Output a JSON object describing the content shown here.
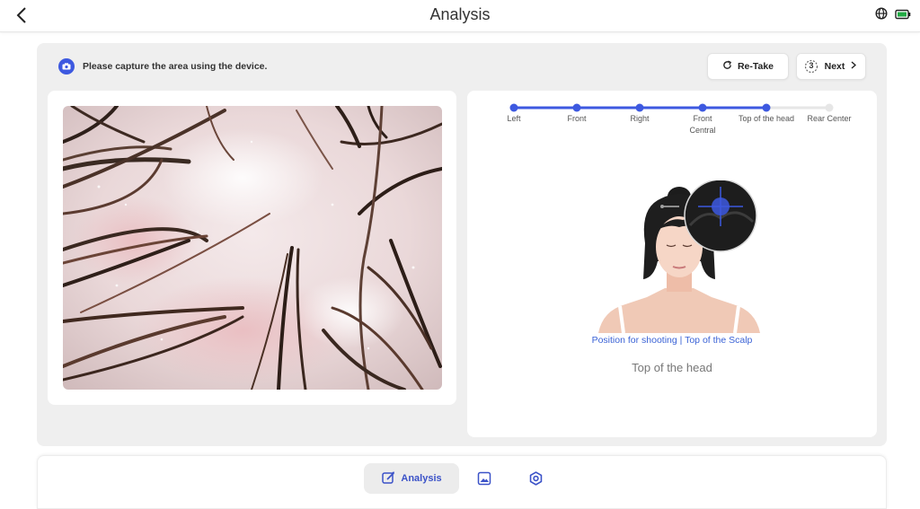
{
  "header": {
    "title": "Analysis"
  },
  "notice": {
    "text": "Please capture the area using the device."
  },
  "buttons": {
    "retake_label": "Re-Take",
    "next_label": "Next",
    "countdown": "3"
  },
  "steps": [
    {
      "label": "Left",
      "state": "done"
    },
    {
      "label": "Front",
      "state": "done"
    },
    {
      "label": "Right",
      "state": "done"
    },
    {
      "label": "Front Central",
      "state": "done"
    },
    {
      "label": "Top of the head",
      "state": "current"
    },
    {
      "label": "Rear Center",
      "state": "pending"
    }
  ],
  "guide": {
    "caption": "Position for shooting | Top of the Scalp",
    "position_name": "Top of the head"
  },
  "bottom_nav": {
    "analysis_label": "Analysis"
  },
  "colors": {
    "accent": "#3d59e0",
    "battery": "#22aa44"
  },
  "icons": [
    "back-arrow-icon",
    "globe-icon",
    "battery-icon",
    "camera-icon",
    "refresh-icon",
    "timer-icon",
    "chevron-right-icon",
    "analysis-icon",
    "gallery-icon",
    "settings-icon"
  ]
}
